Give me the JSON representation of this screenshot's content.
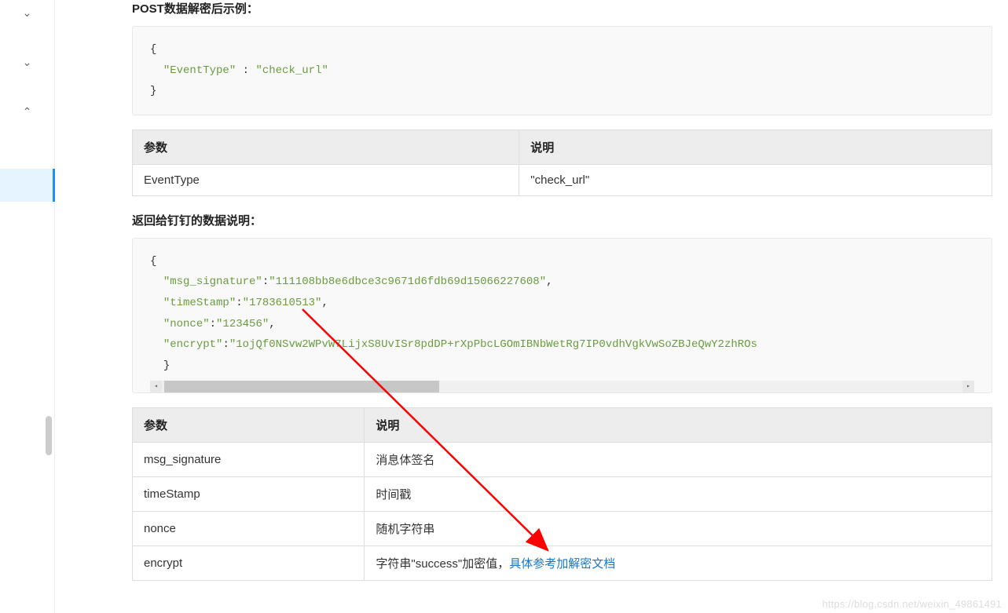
{
  "headings": {
    "top_truncated": "POST数据解密后示例：",
    "response_title": "返回给钉钉的数据说明："
  },
  "code1": {
    "open": "{",
    "key1": "\"EventType\"",
    "colon1": " : ",
    "val1": "\"check_url\"",
    "close": "}"
  },
  "table1": {
    "header_param": "参数",
    "header_desc": "说明",
    "rows": [
      {
        "param": "EventType",
        "desc": "\"check_url\""
      }
    ]
  },
  "code2": {
    "open": "{",
    "k1": "\"msg_signature\"",
    "v1": "\"111108bb8e6dbce3c9671d6fdb69d15066227608\"",
    "k2": "\"timeStamp\"",
    "v2": "\"1783610513\"",
    "k3": "\"nonce\"",
    "v3": "\"123456\"",
    "k4": "\"encrypt\"",
    "v4": "\"1ojQf0NSvw2WPvW7LijxS8UvISr8pdDP+rXpPbcLGOmIBNbWetRg7IP0vdhVgkVwSoZBJeQwY2zhROs",
    "close": "}"
  },
  "table2": {
    "header_param": "参数",
    "header_desc": "说明",
    "rows": [
      {
        "param": "msg_signature",
        "desc": "消息体签名"
      },
      {
        "param": "timeStamp",
        "desc": "时间戳"
      },
      {
        "param": "nonce",
        "desc": "随机字符串"
      },
      {
        "param": "encrypt",
        "desc_prefix": "字符串\"success\"加密值，",
        "desc_link": "具体参考加解密文档"
      }
    ]
  },
  "watermark": "https://blog.csdn.net/weixin_49861491"
}
